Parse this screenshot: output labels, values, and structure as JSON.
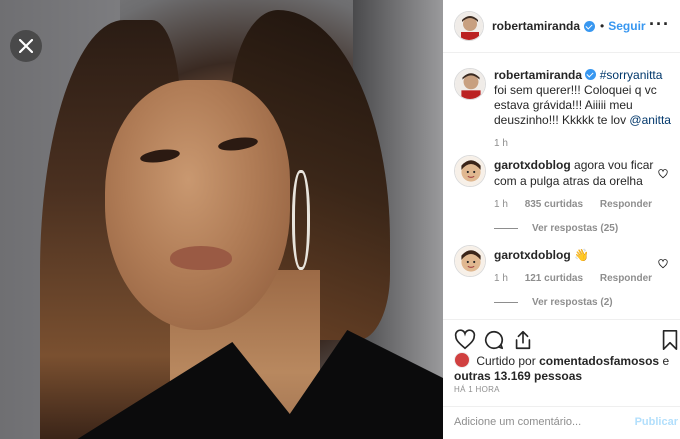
{
  "post": {
    "username": "robertamiranda",
    "follow_label": "Seguir",
    "separator": "•",
    "more_label": "···",
    "caption_hashtag": "#sorryanitta",
    "caption_text_1": "foi sem querer!!! Coloquei q vc estava grávida!!! Aiiiii meu deuszinho!!! Kkkkk te lov",
    "caption_mention": "@anitta",
    "caption_time": "1 h"
  },
  "comments": [
    {
      "username": "garotxdoblog",
      "text": "agora vou ficar com a pulga atras da orelha",
      "time": "1 h",
      "likes": "835 curtidas",
      "reply_label": "Responder",
      "view_replies": "Ver respostas (25)"
    },
    {
      "username": "garotxdoblog",
      "text": "👋",
      "time": "1 h",
      "likes": "121 curtidas",
      "reply_label": "Responder",
      "view_replies": "Ver respostas (2)"
    }
  ],
  "actions": {
    "liked_by_prefix": "Curtido por",
    "liked_by_user": "comentadosfamosos",
    "liked_by_mid": "e",
    "liked_by_others": "outras 13.169 pessoas",
    "time_ago": "HÁ 1 HORA",
    "comment_placeholder": "Adicione um comentário...",
    "publish_label": "Publicar"
  },
  "icons": {
    "close": "close-icon",
    "heart": "heart-icon",
    "comment": "comment-icon",
    "share": "share-icon",
    "bookmark": "bookmark-icon"
  },
  "colors": {
    "accent": "#3897f0",
    "text": "#262626",
    "muted": "#8e8e8e",
    "publish_disabled": "#b2dffc"
  }
}
